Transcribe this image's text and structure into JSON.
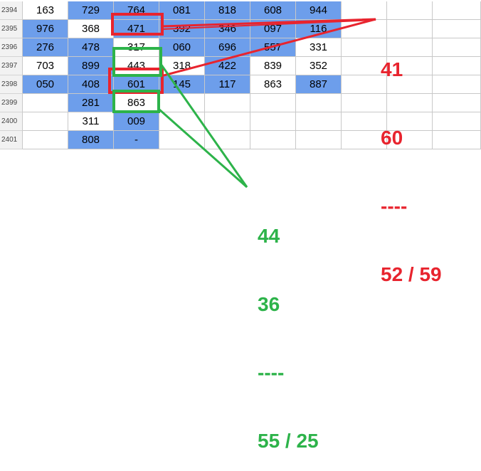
{
  "sheet": {
    "row_numbers": [
      "2394",
      "2395",
      "2396",
      "2397",
      "2398",
      "2399",
      "2400",
      "2401"
    ],
    "rows": [
      {
        "cells": [
          {
            "v": "163",
            "blue": false
          },
          {
            "v": "729",
            "blue": true
          },
          {
            "v": "764",
            "blue": true
          },
          {
            "v": "081",
            "blue": true
          },
          {
            "v": "818",
            "blue": true
          },
          {
            "v": "608",
            "blue": true
          },
          {
            "v": "944",
            "blue": true
          },
          {
            "v": "",
            "blue": false
          },
          {
            "v": "",
            "blue": false
          },
          {
            "v": "",
            "blue": false
          }
        ]
      },
      {
        "cells": [
          {
            "v": "976",
            "blue": true
          },
          {
            "v": "368",
            "blue": false
          },
          {
            "v": "471",
            "blue": true
          },
          {
            "v": "392",
            "blue": true
          },
          {
            "v": "346",
            "blue": true
          },
          {
            "v": "097",
            "blue": true
          },
          {
            "v": "116",
            "blue": true
          },
          {
            "v": "",
            "blue": false
          },
          {
            "v": "",
            "blue": false
          },
          {
            "v": "",
            "blue": false
          }
        ]
      },
      {
        "cells": [
          {
            "v": "276",
            "blue": true
          },
          {
            "v": "478",
            "blue": true
          },
          {
            "v": "317",
            "blue": false
          },
          {
            "v": "060",
            "blue": true
          },
          {
            "v": "696",
            "blue": true
          },
          {
            "v": "557",
            "blue": true
          },
          {
            "v": "331",
            "blue": false
          },
          {
            "v": "",
            "blue": false
          },
          {
            "v": "",
            "blue": false
          },
          {
            "v": "",
            "blue": false
          }
        ]
      },
      {
        "cells": [
          {
            "v": "703",
            "blue": false
          },
          {
            "v": "899",
            "blue": true
          },
          {
            "v": "443",
            "blue": false
          },
          {
            "v": "318",
            "blue": false
          },
          {
            "v": "422",
            "blue": true
          },
          {
            "v": "839",
            "blue": false
          },
          {
            "v": "352",
            "blue": false
          },
          {
            "v": "",
            "blue": false
          },
          {
            "v": "",
            "blue": false
          },
          {
            "v": "",
            "blue": false
          }
        ]
      },
      {
        "cells": [
          {
            "v": "050",
            "blue": true
          },
          {
            "v": "408",
            "blue": true
          },
          {
            "v": "601",
            "blue": true
          },
          {
            "v": "145",
            "blue": true
          },
          {
            "v": "117",
            "blue": true
          },
          {
            "v": "863",
            "blue": false
          },
          {
            "v": "887",
            "blue": true
          },
          {
            "v": "",
            "blue": false
          },
          {
            "v": "",
            "blue": false
          },
          {
            "v": "",
            "blue": false
          }
        ]
      },
      {
        "cells": [
          {
            "v": "",
            "blue": false
          },
          {
            "v": "281",
            "blue": true
          },
          {
            "v": "863",
            "blue": false
          },
          {
            "v": "",
            "blue": false
          },
          {
            "v": "",
            "blue": false
          },
          {
            "v": "",
            "blue": false
          },
          {
            "v": "",
            "blue": false
          },
          {
            "v": "",
            "blue": false
          },
          {
            "v": "",
            "blue": false
          },
          {
            "v": "",
            "blue": false
          }
        ]
      },
      {
        "cells": [
          {
            "v": "",
            "blue": false
          },
          {
            "v": "311",
            "blue": false
          },
          {
            "v": "009",
            "blue": true
          },
          {
            "v": "",
            "blue": false
          },
          {
            "v": "",
            "blue": false
          },
          {
            "v": "",
            "blue": false
          },
          {
            "v": "",
            "blue": false
          },
          {
            "v": "",
            "blue": false
          },
          {
            "v": "",
            "blue": false
          },
          {
            "v": "",
            "blue": false
          }
        ]
      },
      {
        "cells": [
          {
            "v": "",
            "blue": false
          },
          {
            "v": "808",
            "blue": true
          },
          {
            "v": "-",
            "blue": true
          },
          {
            "v": "",
            "blue": false
          },
          {
            "v": "",
            "blue": false
          },
          {
            "v": "",
            "blue": false
          },
          {
            "v": "",
            "blue": false
          },
          {
            "v": "",
            "blue": false
          },
          {
            "v": "",
            "blue": false
          },
          {
            "v": "",
            "blue": false
          }
        ]
      }
    ]
  },
  "annotations": {
    "red": {
      "line1": "41",
      "line2": "60",
      "line3": "----",
      "line4": "52 / 59"
    },
    "green": {
      "line1": "44",
      "line2": "36",
      "line3": "----",
      "line4": "55 / 25"
    }
  },
  "colors": {
    "cell_blue": "#6d9eeb",
    "red": "#e8242e",
    "green": "#2db34a",
    "row_header_bg": "#f2f2f2"
  }
}
